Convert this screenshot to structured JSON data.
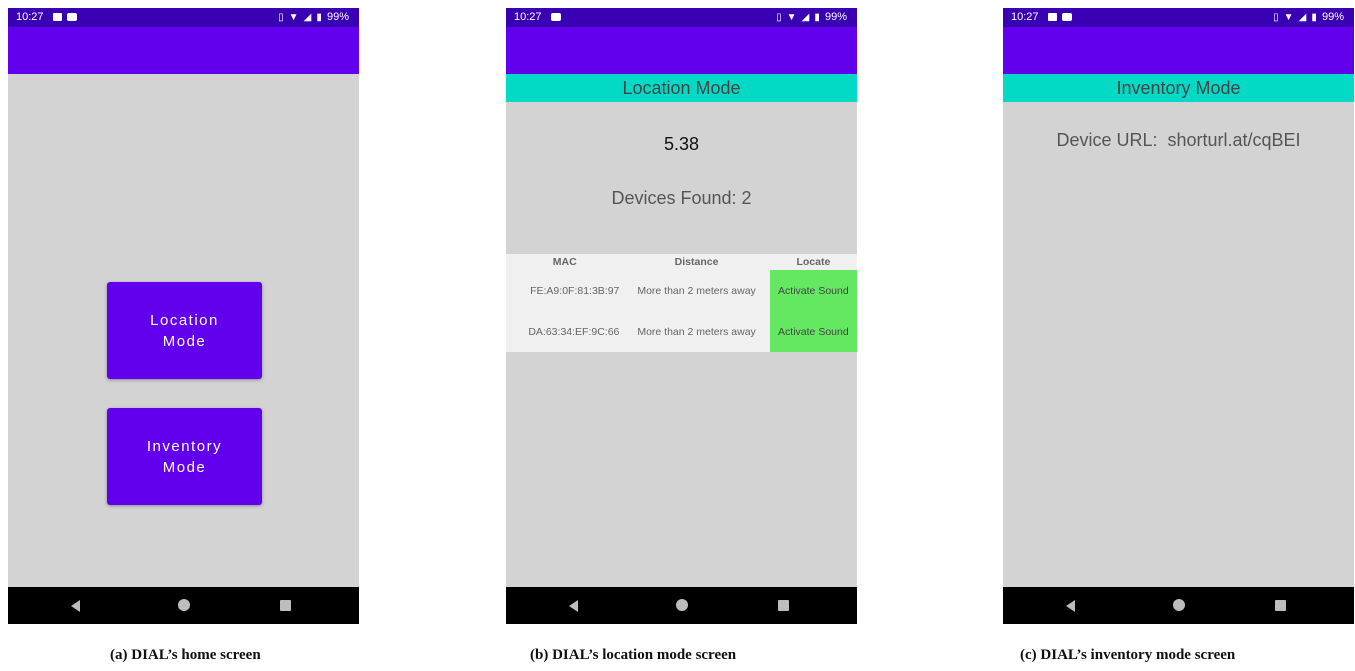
{
  "screens": {
    "home": {
      "status": {
        "time": "10:27",
        "battery": "99%"
      },
      "buttons": {
        "location": "Location Mode",
        "inventory": "Inventory Mode"
      },
      "caption": "(a) DIAL’s home screen"
    },
    "location": {
      "status": {
        "time": "10:27",
        "battery": "99%"
      },
      "header": "Location Mode",
      "distance_value": "5.38",
      "devices_found": "Devices Found: 2",
      "table": {
        "columns": [
          "MAC",
          "Distance",
          "Locate"
        ],
        "rows": [
          {
            "mac": "FE:A9:0F:81:3B:97",
            "distance": "More than 2 meters away",
            "action": "Activate Sound"
          },
          {
            "mac": "DA:63:34:EF:9C:66",
            "distance": "More than 2 meters away",
            "action": "Activate Sound"
          }
        ]
      },
      "caption": "(b) DIAL’s location mode screen"
    },
    "inventory": {
      "status": {
        "time": "10:27",
        "battery": "99%"
      },
      "header": "Inventory Mode",
      "device_url": "Device URL:  shorturl.at/cqBEI",
      "caption": "(c) DIAL’s inventory mode screen"
    }
  },
  "icons": {
    "statusbar": [
      "image-icon",
      "youtube-icon",
      "vibrate-icon",
      "wifi-icon",
      "signal-icon",
      "battery-icon"
    ],
    "navbar": [
      "back-icon",
      "home-icon",
      "recents-icon"
    ]
  },
  "colors": {
    "status_bar": "#3a00b4",
    "app_bar": "#6200ee",
    "mode_header": "#03dac5",
    "locate_cell": "#64e862",
    "screen_bg": "#d3d3d3"
  }
}
